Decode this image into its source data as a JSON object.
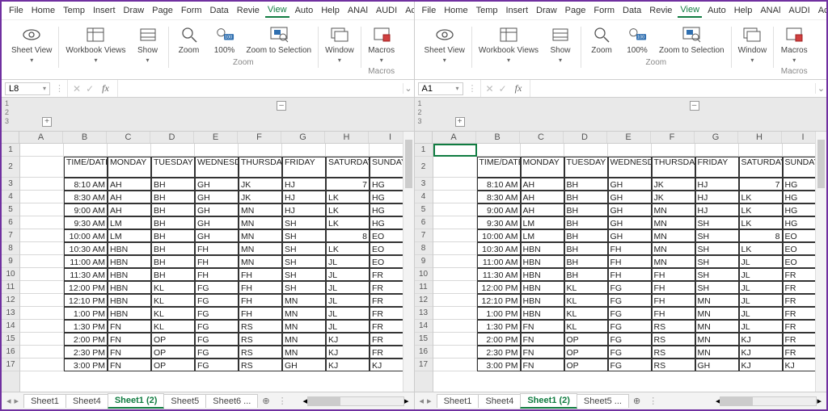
{
  "menus": [
    "File",
    "Home",
    "Temp",
    "Insert",
    "Draw",
    "Page",
    "Form",
    "Data",
    "Revie",
    "View",
    "Auto",
    "Help",
    "ANAl",
    "AUDI",
    "Acrol"
  ],
  "activeMenu": "View",
  "ribbon": {
    "sheetView": "Sheet View",
    "workbookViews": "Workbook Views",
    "show": "Show",
    "zoom": "Zoom",
    "zoom100": "100%",
    "zoomToSel": "Zoom to Selection",
    "window": "Window",
    "macros": "Macros",
    "groupZoom": "Zoom",
    "groupMacros": "Macros"
  },
  "panes": [
    {
      "nameBox": "L8",
      "activeCell": null
    },
    {
      "nameBox": "A1",
      "activeCell": "A1"
    }
  ],
  "columns": [
    "A",
    "B",
    "C",
    "D",
    "E",
    "F",
    "G",
    "H",
    "I"
  ],
  "rowHeaders": [
    "1",
    "2",
    "3",
    "4",
    "5",
    "6",
    "7",
    "8",
    "9",
    "10",
    "11",
    "12",
    "13",
    "14",
    "15",
    "16",
    "17"
  ],
  "headerRow": [
    "",
    "TIME/DATE",
    "MONDAY",
    "TUESDAY",
    "WEDNESDAY",
    "THURSDAY",
    "FRIDAY",
    "SATURDAY",
    "SUNDAY"
  ],
  "rows": [
    [
      "",
      "8:10 AM",
      "AH",
      "BH",
      "GH",
      "JK",
      "HJ",
      "7",
      "HG"
    ],
    [
      "",
      "8:30 AM",
      "AH",
      "BH",
      "GH",
      "JK",
      "HJ",
      "LK",
      "HG"
    ],
    [
      "",
      "9:00 AM",
      "AH",
      "BH",
      "GH",
      "MN",
      "HJ",
      "LK",
      "HG"
    ],
    [
      "",
      "9:30 AM",
      "LM",
      "BH",
      "GH",
      "MN",
      "SH",
      "LK",
      "HG"
    ],
    [
      "",
      "10:00 AM",
      "LM",
      "BH",
      "GH",
      "MN",
      "SH",
      "8",
      "EO"
    ],
    [
      "",
      "10:30 AM",
      "HBN",
      "BH",
      "FH",
      "MN",
      "SH",
      "LK",
      "EO"
    ],
    [
      "",
      "11:00 AM",
      "HBN",
      "BH",
      "FH",
      "MN",
      "SH",
      "JL",
      "EO"
    ],
    [
      "",
      "11:30 AM",
      "HBN",
      "BH",
      "FH",
      "FH",
      "SH",
      "JL",
      "FR"
    ],
    [
      "",
      "12:00 PM",
      "HBN",
      "KL",
      "FG",
      "FH",
      "SH",
      "JL",
      "FR"
    ],
    [
      "",
      "12:10 PM",
      "HBN",
      "KL",
      "FG",
      "FH",
      "MN",
      "JL",
      "FR"
    ],
    [
      "",
      "1:00 PM",
      "HBN",
      "KL",
      "FG",
      "FH",
      "MN",
      "JL",
      "FR"
    ],
    [
      "",
      "1:30 PM",
      "FN",
      "KL",
      "FG",
      "RS",
      "MN",
      "JL",
      "FR"
    ],
    [
      "",
      "2:00 PM",
      "FN",
      "OP",
      "FG",
      "RS",
      "MN",
      "KJ",
      "FR"
    ],
    [
      "",
      "2:30 PM",
      "FN",
      "OP",
      "FG",
      "RS",
      "MN",
      "KJ",
      "FR"
    ],
    [
      "",
      "3:00 PM",
      "FN",
      "OP",
      "FG",
      "RS",
      "GH",
      "KJ",
      "KJ"
    ]
  ],
  "sheets": {
    "left": [
      "Sheet1",
      "Sheet4",
      "Sheet1 (2)",
      "Sheet5",
      "Sheet6 ..."
    ],
    "right": [
      "Sheet1",
      "Sheet4",
      "Sheet1 (2)",
      "Sheet5 ..."
    ],
    "active": "Sheet1 (2)"
  }
}
